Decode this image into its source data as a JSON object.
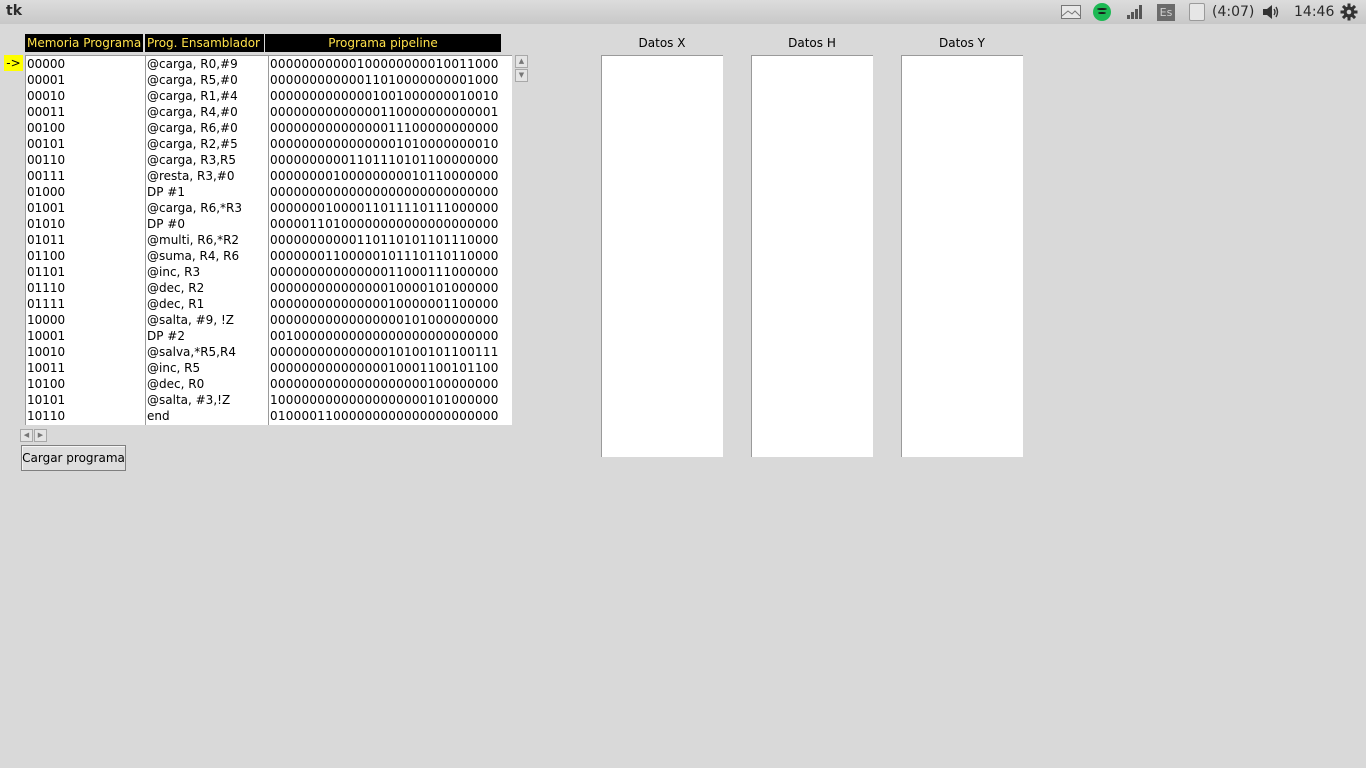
{
  "topbar": {
    "app_title": "tk",
    "battery_text": "(4:07)",
    "clock": "14:46",
    "keyboard_layout": "Es",
    "icons": [
      "mail-icon",
      "spotify-icon",
      "signal-icon",
      "keyboard-layout-icon",
      "battery-icon",
      "volume-icon",
      "gear-icon"
    ]
  },
  "headers": {
    "memoria": "Memoria Programa",
    "ensamblador": "Prog. Ensamblador",
    "pipeline": "Programa pipeline"
  },
  "pointer": "->",
  "colors": {
    "header_bg": "#000000",
    "header_text": "#ffe14a",
    "pointer_bg": "#ffff00",
    "window_bg": "#d9d9d9"
  },
  "memoria": [
    "00000",
    "00001",
    "00010",
    "00011",
    "00100",
    "00101",
    "00110",
    "00111",
    "01000",
    "01001",
    "01010",
    "01011",
    "01100",
    "01101",
    "01110",
    "01111",
    "10000",
    "10001",
    "10010",
    "10011",
    "10100",
    "10101",
    "10110"
  ],
  "ensamblador": [
    "@carga, R0,#9",
    "@carga, R5,#0",
    "@carga, R1,#4",
    "@carga, R4,#0",
    "@carga, R6,#0",
    "@carga, R2,#5",
    "@carga, R3,R5",
    "@resta, R3,#0",
    "DP #1",
    "@carga, R6,*R3",
    "DP #0",
    "@multi, R6,*R2",
    "@suma, R4, R6",
    "@inc, R3",
    "@dec, R2",
    "@dec, R1",
    "@salta, #9, !Z",
    "DP #2",
    "@salva,*R5,R4",
    "@inc, R5",
    "@dec, R0",
    "@salta, #3,!Z",
    "end "
  ],
  "pipeline": [
    "00000000000100000000010011000",
    "00000000000011010000000001000",
    "00000000000001001000000010010",
    "00000000000000110000000000001",
    "00000000000000011100000000000",
    "00000000000000001010000000010",
    "00000000001101110101100000000",
    "00000000100000000010110000000",
    "00000000000000000000000000000",
    "00000001000011011110111000000",
    "00000110100000000000000000000",
    "00000000000110110101101110000",
    "00000001100000101110110110000",
    "00000000000000011000111000000",
    "00000000000000010000101000000",
    "00000000000000010000001100000",
    "00000000000000000101000000000",
    "00100000000000000000000000000",
    "00000000000000010100101100111",
    "00000000000000010001100101100",
    "00000000000000000000100000000",
    "10000000000000000000101000000",
    "01000011000000000000000000000"
  ],
  "load_button": "Cargar programa",
  "data_panels": {
    "x_label": "Datos X",
    "h_label": "Datos H",
    "y_label": "Datos Y"
  }
}
